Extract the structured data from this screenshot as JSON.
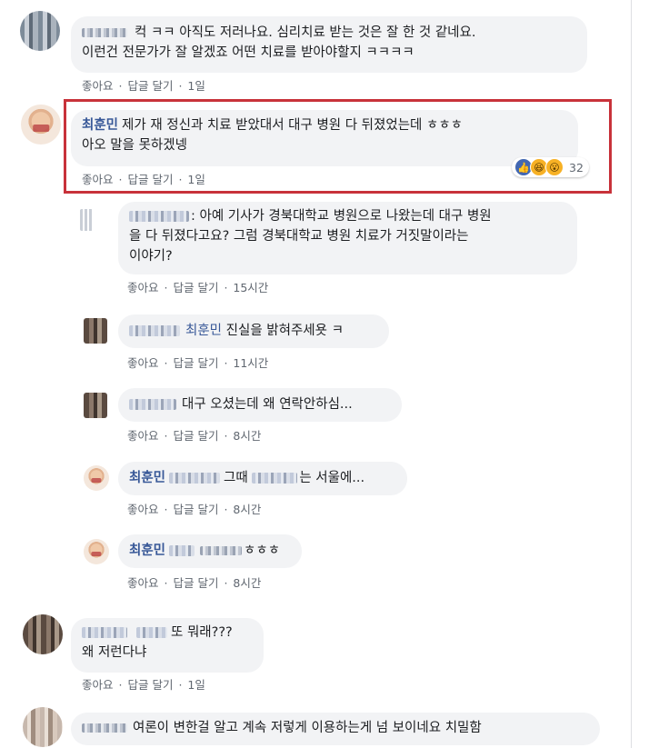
{
  "meta_labels": {
    "like": "좋아요",
    "reply": "답글 달기",
    "sep": "·"
  },
  "comments": [
    {
      "text_line1": "컥 ㅋㅋ 아직도 저러나요. 심리치료 받는 것은 잘 한 것 같네요.",
      "text_line2": "이런건 전문가가 잘 알겠죠 어떤 치료를 받아야할지 ㅋㅋㅋㅋ",
      "time": "1일"
    },
    {
      "name": "최훈민",
      "text_line1": "제가 재 정신과 치료 받았대서 대구 병원 다 뒤졌었는데 ㅎㅎㅎ",
      "text_line2": "아오 말을 못하겠넹",
      "time": "1일",
      "reaction_count": "32"
    },
    {
      "name_blur": "이**",
      "text_line1": ": 아예 기사가 경북대학교 병원으로 나왔는데 대구 병원",
      "text_line2": "을 다 뒤졌다고요? 그럼 경북대학교 병원 치료가 거짓말이라는",
      "text_line3": "이야기?",
      "time": "15시간"
    },
    {
      "mention": "최훈민",
      "text": "진실을 밝혀주세욧 ㅋ",
      "time": "11시간"
    },
    {
      "text": "대구 오셨는데 왜 연락안하심...",
      "time": "8시간"
    },
    {
      "name": "최훈민",
      "text_mid": "그때",
      "text_end": "는 서울에...",
      "time": "8시간"
    },
    {
      "name": "최훈민",
      "text": "ㅎㅎㅎ",
      "time": "8시간"
    },
    {
      "text_line1": "또 뭐래???",
      "text_line2": "왜 저런다냐",
      "time": "1일"
    },
    {
      "text": "여론이 변한걸 알고 계속 저렇게 이용하는게 넘 보이네요 치밀함"
    }
  ]
}
